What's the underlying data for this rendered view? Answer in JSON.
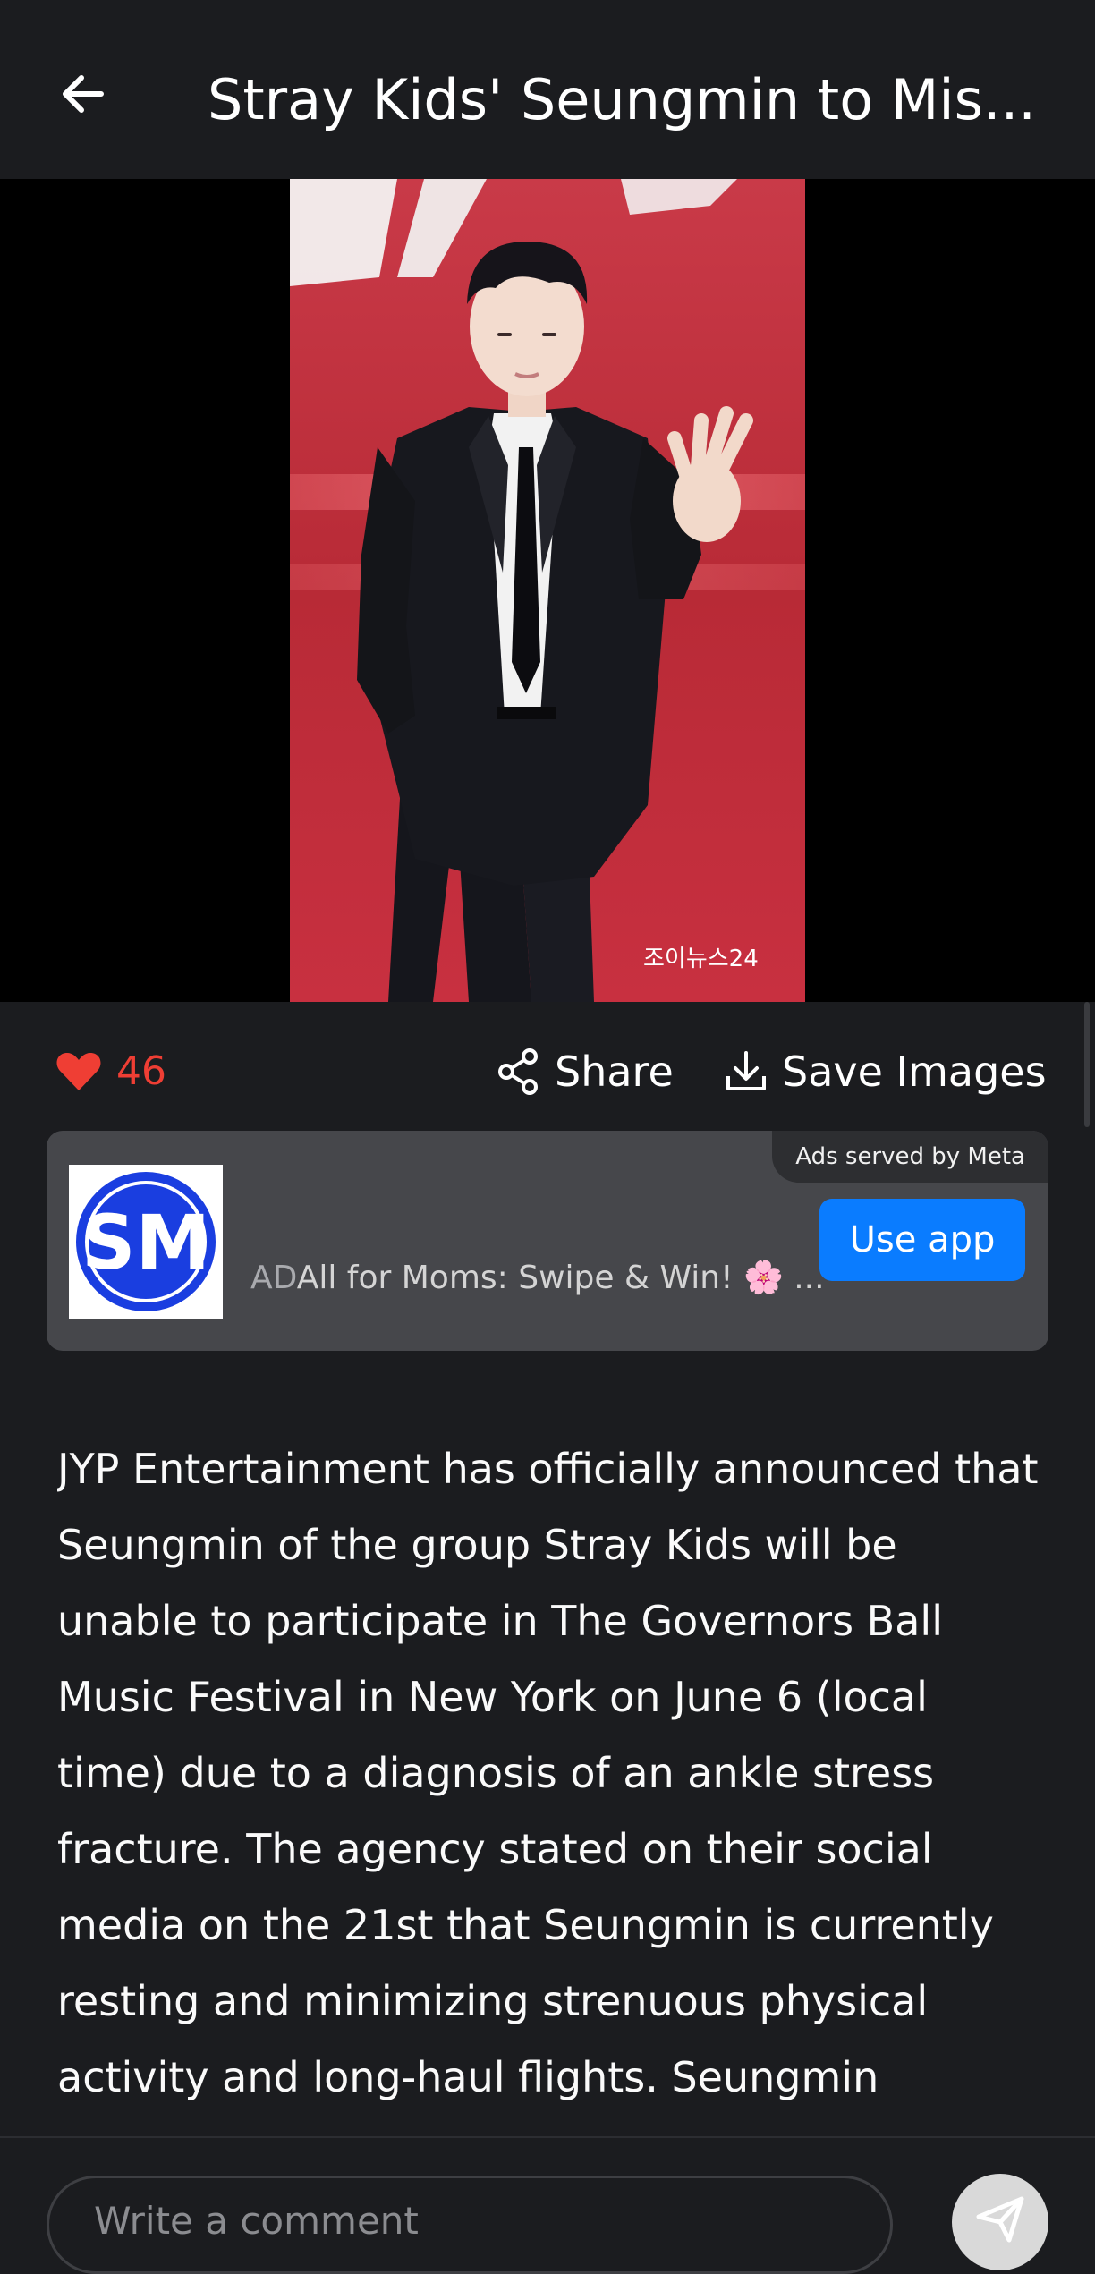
{
  "header": {
    "title": "Stray Kids' Seungmin to Mis...",
    "back_icon": "arrow-left-icon"
  },
  "hero": {
    "watermark": "조이뉴스24"
  },
  "actions": {
    "like_count": "46",
    "like_color": "#ef3e34",
    "share_label": "Share",
    "save_label": "Save Images"
  },
  "ad": {
    "served_by": "Ads served by Meta",
    "ad_marker": "AD",
    "text": "All for Moms: Swipe & Win! 🌸 ...",
    "cta": "Use app",
    "logo_text": "SM",
    "cta_color": "#0a7cff"
  },
  "article": {
    "body": "JYP Entertainment has officially announced that Seungmin of the group Stray Kids will be unable to participate in The Governors Ball Music Festival in New York on June 6 (local time) due to a diagnosis of an ankle stress fracture. The agency stated on their social media on the 21st that Seungmin is currently resting and minimizing strenuous physical activity and long-haul flights. Seungmin"
  },
  "comment": {
    "placeholder": "Write a comment"
  }
}
